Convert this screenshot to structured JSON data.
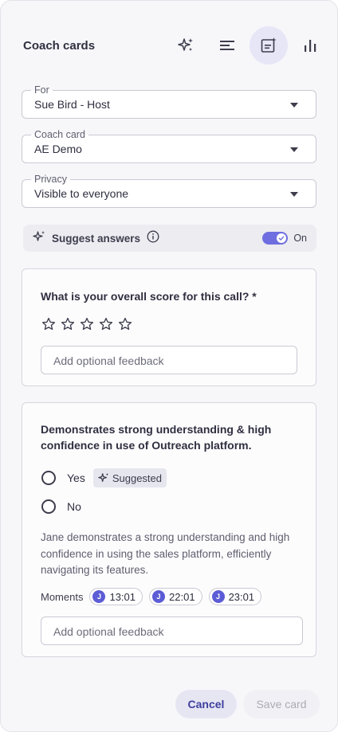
{
  "header": {
    "title": "Coach cards",
    "icons": [
      "sparkle-icon",
      "filter-lines-icon",
      "coach-card-icon",
      "bar-chart-icon"
    ],
    "active_icon": "coach-card-icon"
  },
  "fields": {
    "for": {
      "label": "For",
      "value": "Sue Bird - Host"
    },
    "coach_card": {
      "label": "Coach card",
      "value": "AE Demo"
    },
    "privacy": {
      "label": "Privacy",
      "value": "Visible to everyone"
    }
  },
  "suggest": {
    "label": "Suggest answers",
    "toggle_state": "On",
    "enabled": true
  },
  "card1": {
    "question": "What is your overall score for this call? *",
    "rating_max": 5,
    "rating_value": 0,
    "feedback_placeholder": "Add optional feedback"
  },
  "card2": {
    "question_line1": "Demonstrates strong understanding & high",
    "question_line2": "confidence in use of Outreach platform.",
    "options": [
      {
        "label": "Yes",
        "suggested": true
      },
      {
        "label": "No",
        "suggested": false
      }
    ],
    "suggested_label": "Suggested",
    "desc_line1": "Jane demonstrates a strong understanding and high",
    "desc_line2": "confidence in using the sales platform, efficiently",
    "desc_line3": "navigating its features.",
    "moments_label": "Moments",
    "moments": [
      {
        "initial": "J",
        "time": "13:01"
      },
      {
        "initial": "J",
        "time": "22:01"
      },
      {
        "initial": "J",
        "time": "23:01"
      }
    ],
    "feedback_placeholder": "Add optional feedback"
  },
  "footer": {
    "cancel_label": "Cancel",
    "save_label": "Save card"
  },
  "colors": {
    "accent": "#6e6ee0",
    "avatar": "#5c5cd6",
    "cancel_text": "#3f3f9e"
  }
}
